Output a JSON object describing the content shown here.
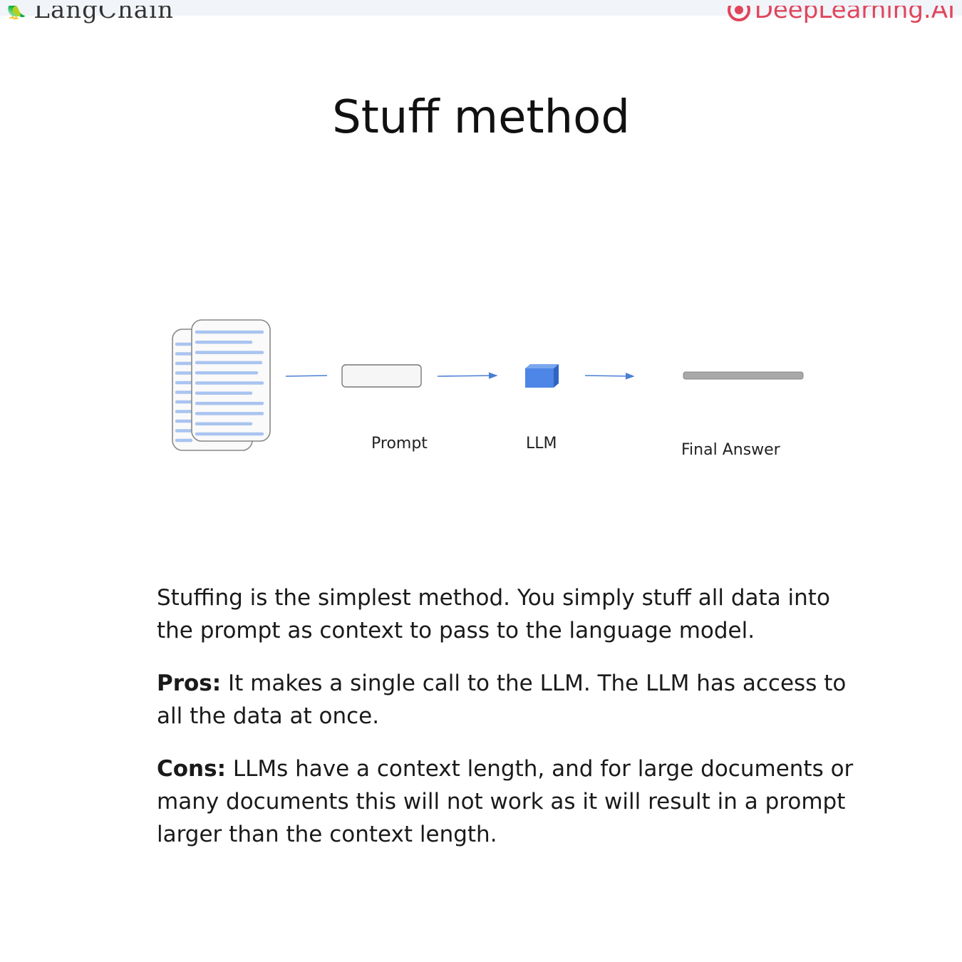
{
  "header": {
    "left_logo_text": "LangChain",
    "right_logo_text": "DeepLearning.AI"
  },
  "slide": {
    "title": "Stuff method"
  },
  "diagram": {
    "labels": {
      "prompt": "Prompt",
      "llm": "LLM",
      "final_answer": "Final Answer"
    },
    "colors": {
      "doc_lines": "#a9c4f0",
      "arrow": "#4a7fd4",
      "llm_cube": "#4d86e6",
      "answer_bar": "#a8a8a8"
    }
  },
  "body": {
    "intro": "Stuffing is the simplest method. You simply stuff all data into the prompt as context to pass to the language model.",
    "pros_label": "Pros:",
    "pros_text": " It makes a single call to the LLM. The LLM has access to all the data at once.",
    "cons_label": "Cons:",
    "cons_text": " LLMs have a context length, and for large documents or many documents this will not work as it will result in a prompt larger than the context length."
  }
}
